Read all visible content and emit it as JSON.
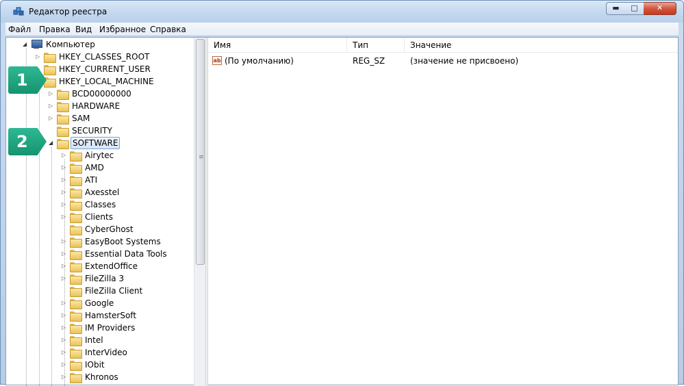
{
  "window": {
    "title": "Редактор реестра",
    "controls": {
      "minimize": "▬",
      "maximize": "□",
      "close": "✕"
    }
  },
  "menu": [
    "Файл",
    "Правка",
    "Вид",
    "Избранное",
    "Справка"
  ],
  "tree": {
    "root": "Компьютер",
    "hives": [
      "HKEY_CLASSES_ROOT",
      "HKEY_CURRENT_USER",
      "HKEY_LOCAL_MACHINE"
    ],
    "hklm_children": [
      "BCD00000000",
      "HARDWARE",
      "SAM",
      "SECURITY",
      "SOFTWARE"
    ],
    "selected": "SOFTWARE",
    "software_children": [
      "Airytec",
      "AMD",
      "ATI",
      "Axesstel",
      "Classes",
      "Clients",
      "CyberGhost",
      "EasyBoot Systems",
      "Essential Data Tools",
      "ExtendOffice",
      "FileZilla 3",
      "FileZilla Client",
      "Google",
      "HamsterSoft",
      "IM Providers",
      "Intel",
      "InterVideo",
      "IObit",
      "Khronos"
    ]
  },
  "list": {
    "columns": [
      "Имя",
      "Тип",
      "Значение"
    ],
    "rows": [
      {
        "name": "(По умолчанию)",
        "type": "REG_SZ",
        "value": "(значение не присвоено)"
      }
    ]
  },
  "badges": [
    "1",
    "2"
  ],
  "icons": {
    "app": "registry-editor-icon",
    "value": "string-value-ab-icon",
    "folder": "folder-icon",
    "computer": "computer-icon"
  },
  "colors": {
    "badge": "#1fa47f",
    "selection_border": "#7da2ce"
  }
}
